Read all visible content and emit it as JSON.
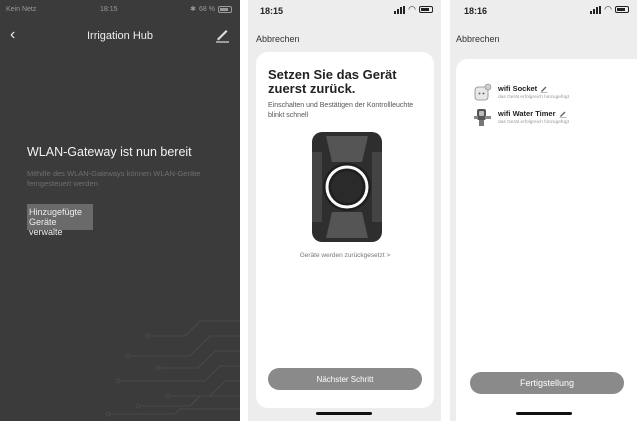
{
  "phone1": {
    "status": {
      "carrier": "Kein Netz",
      "time": "18:15",
      "battery": "68 %"
    },
    "nav": {
      "title": "Irrigation Hub"
    },
    "title": "WLAN-Gateway ist nun bereit",
    "description": "Mithilfe des WLAN-Gateways können WLAN-Geräte ferngesteuert werden",
    "manage_button": "Hinzugefügte Geräte verwalte"
  },
  "phone2": {
    "status": {
      "time": "18:15"
    },
    "cancel": "Abbrechen",
    "title": "Setzen Sie das Gerät zuerst zurück.",
    "description": "Einschalten und Bestätigen der Kontrollleuchte blinkt schnell",
    "reset_link": "Geräte werden zurückgesetzt >",
    "next_button": "Nächster Schritt"
  },
  "phone3": {
    "status": {
      "time": "18:16"
    },
    "cancel": "Abbrechen",
    "devices": [
      {
        "name": "wifi Socket",
        "status": "das Gerät erfolgreich hinzugefügt",
        "icon": "socket-icon"
      },
      {
        "name": "wifi Water Timer",
        "status": "das Gerät erfolgreich hinzugefügt",
        "icon": "water-timer-icon"
      }
    ],
    "finish_button": "Fertigstellung"
  },
  "colors": {
    "dark_bg": "#3b3b3b",
    "light_bg": "#ededed",
    "button_gray": "#8a8a8a"
  }
}
